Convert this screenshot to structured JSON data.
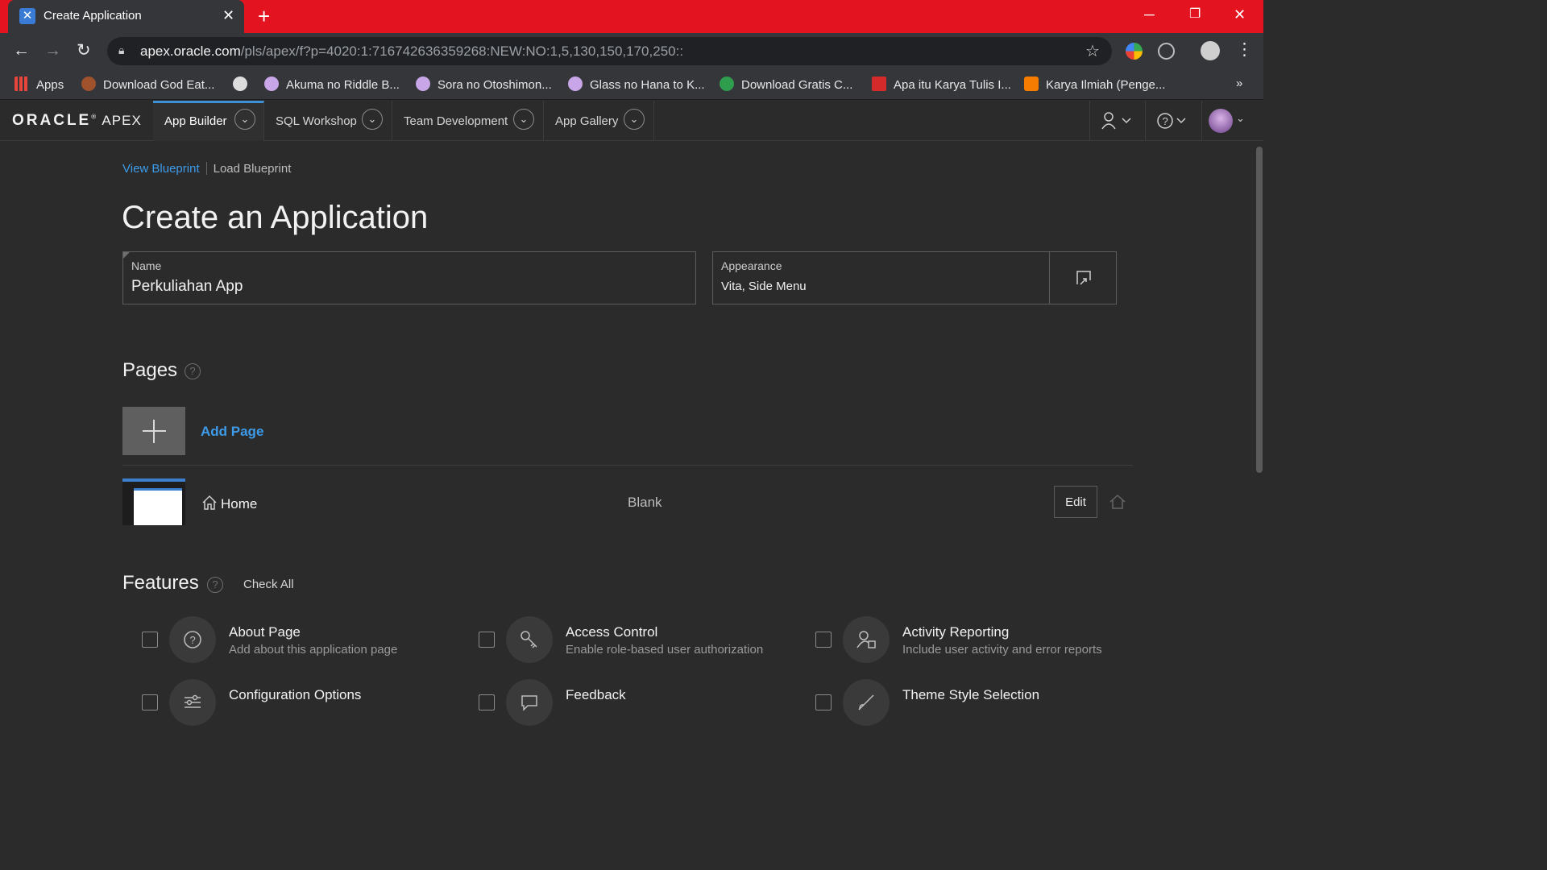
{
  "browser": {
    "tab_title": "Create Application",
    "url_host": "apex.oracle.com",
    "url_path": "/pls/apex/f?p=4020:1:716742636359268:NEW:NO:1,5,130,150,170,250::",
    "bookmarks": [
      {
        "label": "Apps",
        "color": "#e8453c"
      },
      {
        "label": "Download God Eat...",
        "color": "#a0522d"
      },
      {
        "label": "",
        "color": "#dddddd"
      },
      {
        "label": "Akuma no Riddle B...",
        "color": "#c9a6e8"
      },
      {
        "label": "Sora no Otoshimon...",
        "color": "#c9a6e8"
      },
      {
        "label": "Glass no Hana to K...",
        "color": "#c9a6e8"
      },
      {
        "label": "Download Gratis C...",
        "color": "#2e9d4e"
      },
      {
        "label": "Apa itu Karya Tulis I...",
        "color": "#d42a2a"
      },
      {
        "label": "Karya Ilmiah (Penge...",
        "color": "#f57c00"
      }
    ],
    "bookmarks_overflow": "»"
  },
  "apex": {
    "logo_oracle": "ORACLE",
    "logo_apex": "APEX",
    "tabs": [
      {
        "label": "App Builder"
      },
      {
        "label": "SQL Workshop"
      },
      {
        "label": "Team Development"
      },
      {
        "label": "App Gallery"
      }
    ]
  },
  "page": {
    "breadcrumb": {
      "view": "View Blueprint",
      "load": "Load Blueprint"
    },
    "title": "Create an Application",
    "name_field": {
      "label": "Name",
      "value": "Perkuliahan App"
    },
    "appearance_field": {
      "label": "Appearance",
      "value": "Vita, Side Menu"
    },
    "pages_heading": "Pages",
    "add_page": "Add Page",
    "pages": [
      {
        "name": "Home",
        "type": "Blank",
        "edit_label": "Edit"
      }
    ],
    "features_heading": "Features",
    "check_all": "Check All",
    "features": [
      {
        "title": "About Page",
        "desc": "Add about this application page",
        "icon": "help-icon"
      },
      {
        "title": "Access Control",
        "desc": "Enable role-based user authorization",
        "icon": "key-icon"
      },
      {
        "title": "Activity Reporting",
        "desc": "Include user activity and error reports",
        "icon": "user-chart-icon"
      },
      {
        "title": "Configuration Options",
        "desc": "",
        "icon": "sliders-icon"
      },
      {
        "title": "Feedback",
        "desc": "",
        "icon": "comment-icon"
      },
      {
        "title": "Theme Style Selection",
        "desc": "",
        "icon": "brush-icon"
      }
    ]
  },
  "colors": {
    "tabbar": "#e3141f",
    "background": "#2b2b2b",
    "link": "#3d9be9"
  }
}
